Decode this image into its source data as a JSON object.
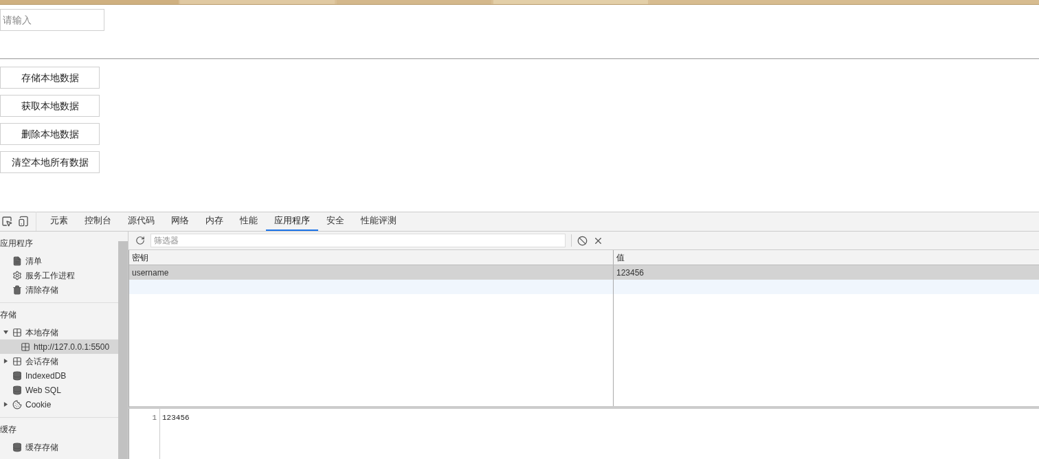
{
  "page": {
    "input": {
      "placeholder": "请输入"
    },
    "buttons": [
      "存储本地数据",
      "获取本地数据",
      "删除本地数据",
      "清空本地所有数据"
    ]
  },
  "devtools": {
    "tabs": [
      {
        "label": "元素",
        "selected": false
      },
      {
        "label": "控制台",
        "selected": false
      },
      {
        "label": "源代码",
        "selected": false
      },
      {
        "label": "网络",
        "selected": false
      },
      {
        "label": "内存",
        "selected": false
      },
      {
        "label": "性能",
        "selected": false
      },
      {
        "label": "应用程序",
        "selected": true
      },
      {
        "label": "安全",
        "selected": false
      },
      {
        "label": "性能评测",
        "selected": false
      }
    ],
    "sidebar": {
      "sections": [
        {
          "title": "应用程序",
          "items": [
            {
              "label": "清单",
              "kind": "file",
              "selected": false
            },
            {
              "label": "服务工作进程",
              "kind": "gear",
              "selected": false
            },
            {
              "label": "清除存储",
              "kind": "trash",
              "selected": false
            }
          ]
        },
        {
          "title": "存储",
          "items": [
            {
              "label": "本地存储",
              "kind": "grid",
              "expanded": true,
              "selected": false,
              "children": [
                {
                  "label": "http://127.0.0.1:5500",
                  "kind": "grid",
                  "selected": true
                }
              ]
            },
            {
              "label": "会话存储",
              "kind": "grid",
              "expanded": false,
              "selected": false
            },
            {
              "label": "IndexedDB",
              "kind": "database",
              "selected": false
            },
            {
              "label": "Web SQL",
              "kind": "database",
              "selected": false
            },
            {
              "label": "Cookie",
              "kind": "cookie",
              "expanded": false,
              "selected": false
            }
          ]
        },
        {
          "title": "缓存",
          "items": [
            {
              "label": "缓存存储",
              "kind": "database",
              "selected": false
            }
          ]
        }
      ]
    },
    "toolbar": {
      "filter": {
        "placeholder": "筛选器"
      }
    },
    "table": {
      "columns": [
        "密钥",
        "值"
      ],
      "rows": [
        {
          "cells": [
            "username",
            "123456"
          ],
          "selected": true
        }
      ]
    },
    "preview": {
      "lines": [
        {
          "number": "1",
          "text": "123456"
        }
      ]
    }
  }
}
